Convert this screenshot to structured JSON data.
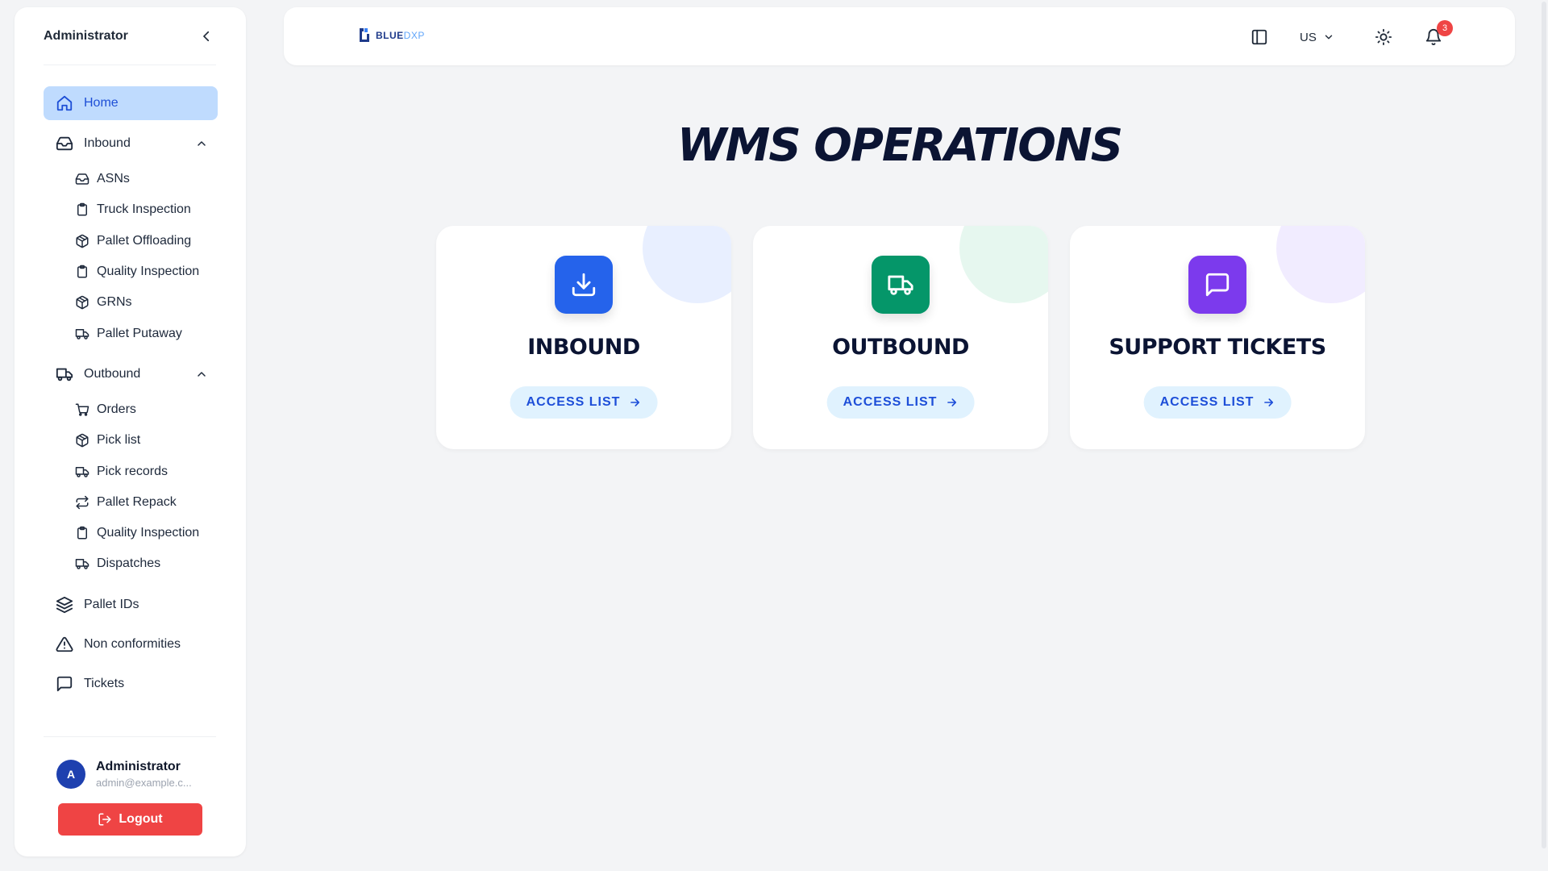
{
  "sidebar": {
    "title": "Administrator",
    "nav": {
      "home": "Home",
      "inbound": "Inbound",
      "inbound_items": [
        "ASNs",
        "Truck Inspection",
        "Pallet Offloading",
        "Quality Inspection",
        "GRNs",
        "Pallet Putaway"
      ],
      "outbound": "Outbound",
      "outbound_items": [
        "Orders",
        "Pick list",
        "Pick records",
        "Pallet Repack",
        "Quality Inspection",
        "Dispatches"
      ],
      "pallet_ids": "Pallet IDs",
      "non_conformities": "Non conformities",
      "tickets": "Tickets"
    },
    "user": {
      "initial": "A",
      "name": "Administrator",
      "email": "admin@example.c..."
    },
    "logout_label": "Logout"
  },
  "topbar": {
    "logo_part1": "BLUE",
    "logo_part2": "DXP",
    "language": "US",
    "notification_count": "3"
  },
  "main": {
    "title": "WMS OPERATIONS",
    "cards": [
      {
        "name": "INBOUND",
        "action": "ACCESS LIST",
        "icon": "download-icon",
        "color": "#2563eb",
        "blob": "#e8efff"
      },
      {
        "name": "OUTBOUND",
        "action": "ACCESS LIST",
        "icon": "truck-icon",
        "color": "#059669",
        "blob": "#e6f7ef"
      },
      {
        "name": "SUPPORT TICKETS",
        "action": "ACCESS LIST",
        "icon": "message-square-icon",
        "color": "#7c3aed",
        "blob": "#f1ecff"
      }
    ]
  },
  "colors": {
    "accent": "#1d4ed8",
    "active_bg": "#bfdbfe",
    "danger": "#ef4444"
  }
}
